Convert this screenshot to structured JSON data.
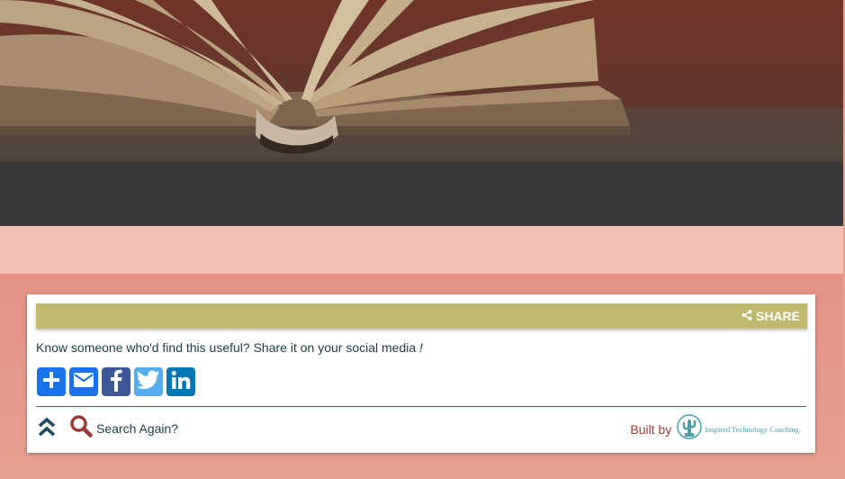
{
  "hero": {
    "image": "open-book-on-table"
  },
  "share_panel": {
    "header_label": "SHARE",
    "header_icon": "share-icon",
    "prompt": "Know someone who'd find this useful? Share it on your social media",
    "prompt_end": "!",
    "social_buttons": [
      {
        "name": "add-to-any",
        "icon": "plus-icon",
        "color": "#1a73e8"
      },
      {
        "name": "email",
        "icon": "email-icon",
        "color": "#1a73e8"
      },
      {
        "name": "facebook",
        "icon": "facebook-icon",
        "color": "#3b5998"
      },
      {
        "name": "twitter",
        "icon": "twitter-icon",
        "color": "#55acee"
      },
      {
        "name": "linkedin",
        "icon": "linkedin-icon",
        "color": "#0077b5"
      }
    ]
  },
  "footer": {
    "search_label": "Search Again?",
    "built_by_label": "Built by",
    "company_name": "Inspired Technology Coaching."
  },
  "colors": {
    "accent": "#9a3b35",
    "share_bar": "#c0b970",
    "text": "#1c3b4a",
    "band": "#f1c2b3",
    "brand": "#4a9fa8"
  }
}
